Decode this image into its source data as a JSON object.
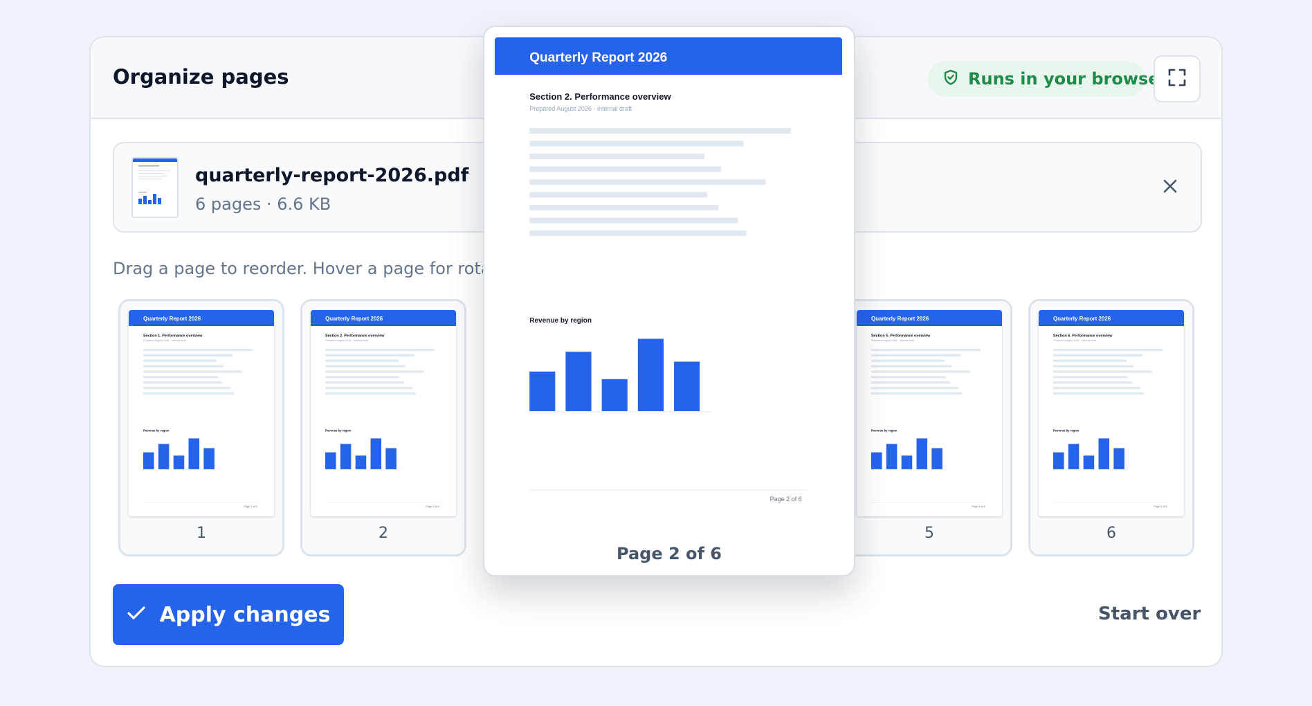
{
  "header": {
    "title": "Organize pages",
    "badge_label": "Runs in your browser",
    "badge_icon": "shield-check-icon",
    "fullscreen_icon": "fullscreen-icon"
  },
  "file": {
    "name": "quarterly-report-2026.pdf",
    "meta": "6 pages · 6.6 KB",
    "close_icon": "close-icon"
  },
  "hint": "Drag a page to reorder. Hover a page for rotate a",
  "page_template": {
    "report_title": "Quarterly Report 2026",
    "draft_note": "Prepared August 2026 · internal draft",
    "chart_label": "Revenue by region",
    "chart_values": [
      52,
      78,
      42,
      95,
      65
    ]
  },
  "pages": [
    {
      "number": "1",
      "section": "Section 1. Performance overview",
      "footer": "Page 1 of 6"
    },
    {
      "number": "2",
      "section": "Section 2. Performance overview",
      "footer": "Page 2 of 6"
    },
    {
      "number": "5",
      "section": "Section 5. Performance overview",
      "footer": "Page 5 of 6"
    },
    {
      "number": "6",
      "section": "Section 6. Performance overview",
      "footer": "Page 6 of 6"
    }
  ],
  "preview": {
    "section": "Section 2. Performance overview",
    "footer": "Page 2 of 6",
    "caption": "Page 2 of 6"
  },
  "actions": {
    "apply_label": "Apply changes",
    "apply_icon": "check-icon",
    "start_over_label": "Start over"
  },
  "colors": {
    "accent": "#2563eb",
    "badge_text": "#1e8a48",
    "badge_bg": "#e9f6ee"
  }
}
